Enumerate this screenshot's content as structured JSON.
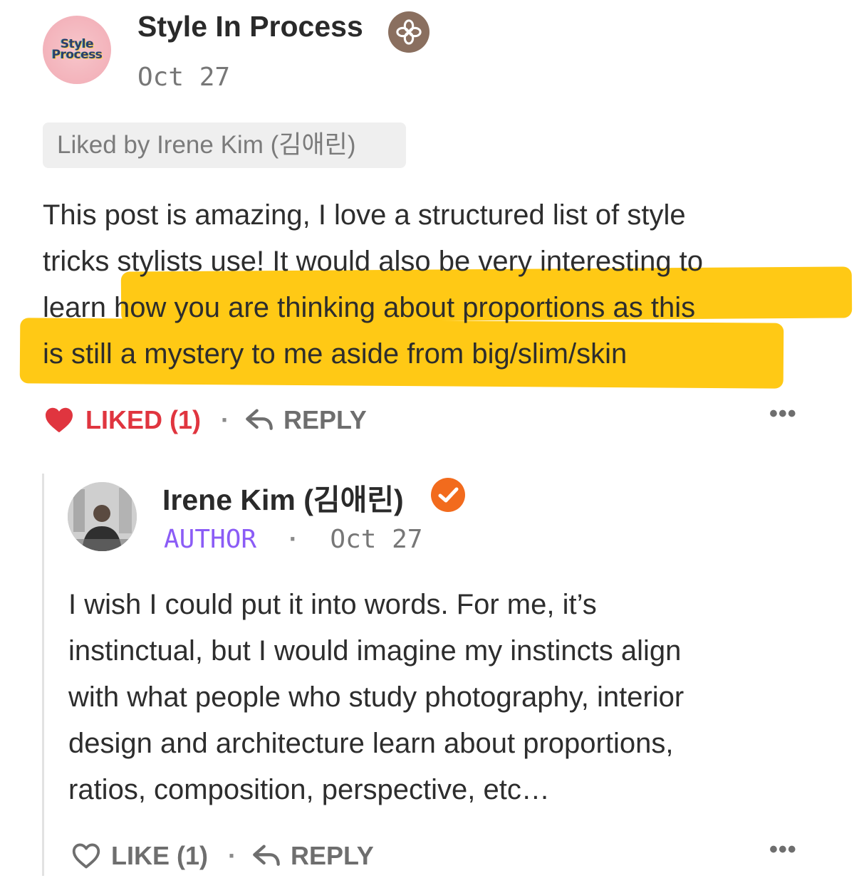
{
  "comment": {
    "author": "Style In Process",
    "avatar_text": [
      "Style",
      "Process"
    ],
    "badge_icon": "flower-icon",
    "date": "Oct 27",
    "liked_by": "Liked by Irene Kim (김애린)",
    "text_lines": [
      "This post is amazing, I love a structured list of style",
      "tricks stylists use! It would also be very interesting to",
      "learn how you are thinking about proportions as this",
      "is still a mystery to me aside from big/slim/skin"
    ],
    "highlight_color": "#ffc915",
    "actions": {
      "liked_label": "LIKED (1)",
      "separator": "·",
      "reply_label": "REPLY",
      "more_label": "•••"
    },
    "liked_color": "#e0353f"
  },
  "reply": {
    "author": "Irene Kim (김애린)",
    "verified_icon": "verified-check-icon",
    "verified_color": "#f26b1d",
    "role_tag": "AUTHOR",
    "role_color": "#8b5cf6",
    "separator": "·",
    "date": "Oct 27",
    "text_lines": [
      "I wish I could put it into words. For me, it’s",
      "instinctual, but I would imagine  my instincts align",
      "with what people who study photography, interior",
      "design and architecture learn about proportions,",
      "ratios, composition, perspective, etc…"
    ],
    "actions": {
      "like_label": "LIKE (1)",
      "separator": "·",
      "reply_label": "REPLY",
      "more_label": "•••"
    }
  }
}
